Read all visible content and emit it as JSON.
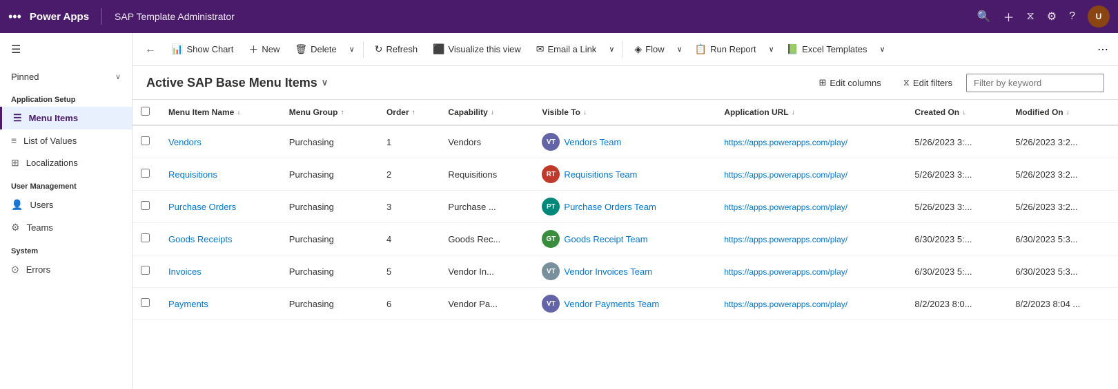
{
  "topNav": {
    "brand": "Power Apps",
    "title": "SAP Template Administrator",
    "avatarInitials": "U"
  },
  "sidebar": {
    "hamburgerIcon": "☰",
    "pinned": "Pinned",
    "sections": [
      {
        "header": "Application Setup",
        "items": [
          {
            "id": "menu-items",
            "label": "Menu Items",
            "icon": "☰",
            "active": true
          },
          {
            "id": "list-of-values",
            "label": "List of Values",
            "icon": "≡",
            "active": false
          },
          {
            "id": "localizations",
            "label": "Localizations",
            "icon": "⊞",
            "active": false
          }
        ]
      },
      {
        "header": "User Management",
        "items": [
          {
            "id": "users",
            "label": "Users",
            "icon": "👤",
            "active": false
          },
          {
            "id": "teams",
            "label": "Teams",
            "icon": "⚙",
            "active": false
          }
        ]
      },
      {
        "header": "System",
        "items": [
          {
            "id": "errors",
            "label": "Errors",
            "icon": "⊙",
            "active": false
          }
        ]
      }
    ]
  },
  "toolbar": {
    "backIcon": "←",
    "showChart": "Show Chart",
    "new": "New",
    "delete": "Delete",
    "refresh": "Refresh",
    "visualizeView": "Visualize this view",
    "emailLink": "Email a Link",
    "flow": "Flow",
    "runReport": "Run Report",
    "excelTemplates": "Excel Templates",
    "moreIcon": "⋯"
  },
  "viewHeader": {
    "title": "Active SAP Base Menu Items",
    "chevron": "∨",
    "editColumns": "Edit columns",
    "editFilters": "Edit filters",
    "filterPlaceholder": "Filter by keyword"
  },
  "table": {
    "columns": [
      {
        "id": "menu-item-name",
        "label": "Menu Item Name",
        "sortable": true,
        "sortDir": "↓"
      },
      {
        "id": "menu-group",
        "label": "Menu Group",
        "sortable": true,
        "sortDir": "↑"
      },
      {
        "id": "order",
        "label": "Order",
        "sortable": true,
        "sortDir": "↑"
      },
      {
        "id": "capability",
        "label": "Capability",
        "sortable": true,
        "sortDir": "↓"
      },
      {
        "id": "visible-to",
        "label": "Visible To",
        "sortable": true,
        "sortDir": "↓"
      },
      {
        "id": "application-url",
        "label": "Application URL",
        "sortable": true,
        "sortDir": "↓"
      },
      {
        "id": "created-on",
        "label": "Created On",
        "sortable": true,
        "sortDir": "↓"
      },
      {
        "id": "modified-on",
        "label": "Modified On",
        "sortable": true,
        "sortDir": "↓"
      }
    ],
    "rows": [
      {
        "menuItemName": "Vendors",
        "menuGroup": "Purchasing",
        "order": "1",
        "capability": "Vendors",
        "visibleToInitials": "VT",
        "visibleToColor": "avatar-purple",
        "visibleToLabel": "Vendors Team",
        "applicationUrl": "https://apps.powerapps.com/play/",
        "createdOn": "5/26/2023 3:...",
        "modifiedOn": "5/26/2023 3:2..."
      },
      {
        "menuItemName": "Requisitions",
        "menuGroup": "Purchasing",
        "order": "2",
        "capability": "Requisitions",
        "visibleToInitials": "RT",
        "visibleToColor": "avatar-red",
        "visibleToLabel": "Requisitions Team",
        "applicationUrl": "https://apps.powerapps.com/play/",
        "createdOn": "5/26/2023 3:...",
        "modifiedOn": "5/26/2023 3:2..."
      },
      {
        "menuItemName": "Purchase Orders",
        "menuGroup": "Purchasing",
        "order": "3",
        "capability": "Purchase ...",
        "visibleToInitials": "PT",
        "visibleToColor": "avatar-teal",
        "visibleToLabel": "Purchase Orders Team",
        "applicationUrl": "https://apps.powerapps.com/play/",
        "createdOn": "5/26/2023 3:...",
        "modifiedOn": "5/26/2023 3:2..."
      },
      {
        "menuItemName": "Goods Receipts",
        "menuGroup": "Purchasing",
        "order": "4",
        "capability": "Goods Rec...",
        "visibleToInitials": "GT",
        "visibleToColor": "avatar-green",
        "visibleToLabel": "Goods Receipt Team",
        "applicationUrl": "https://apps.powerapps.com/play/",
        "createdOn": "6/30/2023 5:...",
        "modifiedOn": "6/30/2023 5:3..."
      },
      {
        "menuItemName": "Invoices",
        "menuGroup": "Purchasing",
        "order": "5",
        "capability": "Vendor In...",
        "visibleToInitials": "VT",
        "visibleToColor": "avatar-gray",
        "visibleToLabel": "Vendor Invoices Team",
        "applicationUrl": "https://apps.powerapps.com/play/",
        "createdOn": "6/30/2023 5:...",
        "modifiedOn": "6/30/2023 5:3..."
      },
      {
        "menuItemName": "Payments",
        "menuGroup": "Purchasing",
        "order": "6",
        "capability": "Vendor Pa...",
        "visibleToInitials": "VT",
        "visibleToColor": "avatar-purple",
        "visibleToLabel": "Vendor Payments Team",
        "applicationUrl": "https://apps.powerapps.com/play/",
        "createdOn": "8/2/2023 8:0...",
        "modifiedOn": "8/2/2023 8:04 ..."
      }
    ]
  }
}
